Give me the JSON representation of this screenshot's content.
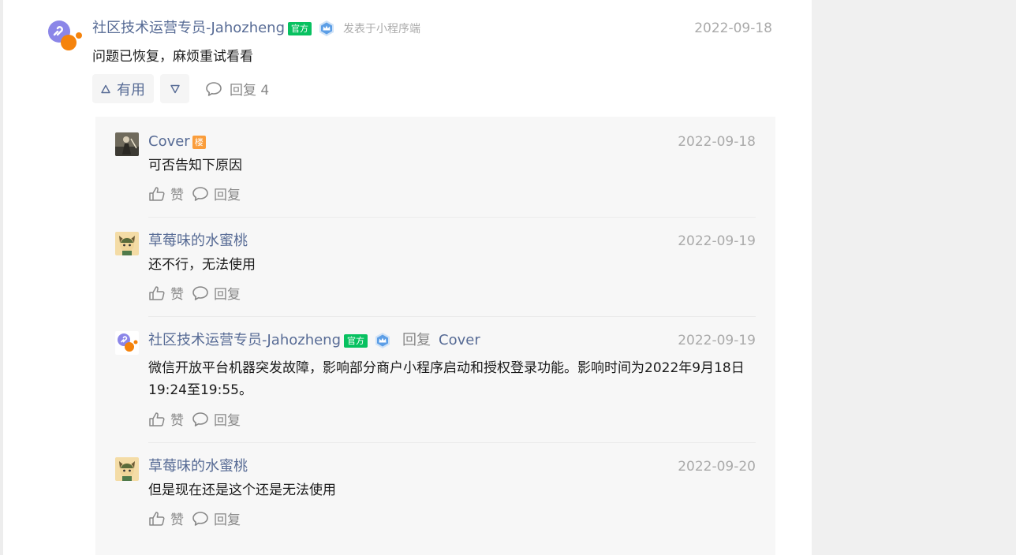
{
  "post": {
    "author": "社区技术运营专员-Jahozheng",
    "official_badge": "官方",
    "source": "发表于小程序端",
    "date": "2022-09-18",
    "text": "问题已恢复，麻烦重试看看",
    "useful_label": "有用",
    "reply_label": "回复 4"
  },
  "replies": [
    {
      "author": "Cover",
      "badge": "楼",
      "date": "2022-09-18",
      "text": "可否告知下原因",
      "like": "赞",
      "reply": "回复"
    },
    {
      "author": "草莓味的水蜜桃",
      "date": "2022-09-19",
      "text": "还不行，无法使用",
      "like": "赞",
      "reply": "回复"
    },
    {
      "author": "社区技术运营专员-Jahozheng",
      "badge": "官方",
      "reply_to_label": "回复",
      "reply_target": "Cover",
      "date": "2022-09-19",
      "text": "微信开放平台机器突发故障，影响部分商户小程序启动和授权登录功能。影响时间为2022年9月18日19:24至19:55。",
      "like": "赞",
      "reply": "回复"
    },
    {
      "author": "草莓味的水蜜桃",
      "date": "2022-09-20",
      "text": "但是现在还是这个还是无法使用",
      "like": "赞",
      "reply": "回复"
    }
  ],
  "colors": {
    "link": "#576b95",
    "official": "#07c160",
    "floor": "#fa9d3b",
    "panel": "#f7f7f7"
  }
}
